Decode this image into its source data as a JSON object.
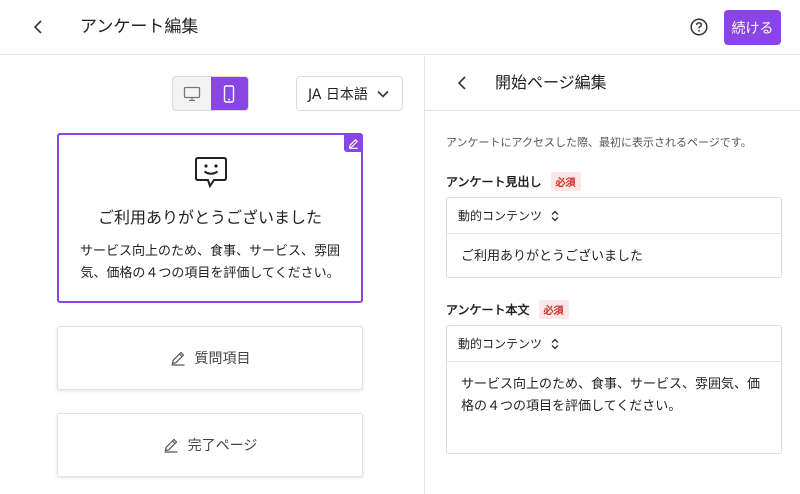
{
  "header": {
    "title": "アンケート編集",
    "continue_label": "続ける"
  },
  "left": {
    "language_label": "JA 日本語",
    "start_card": {
      "heading": "ご利用ありがとうございました",
      "body": "サービス向上のため、食事、サービス、雰囲気、価格の４つの項目を評価してください。"
    },
    "questions_label": "質問項目",
    "complete_label": "完了ページ"
  },
  "right": {
    "title": "開始ページ編集",
    "description": "アンケートにアクセスした際、最初に表示されるページです。",
    "heading_field": {
      "label": "アンケート見出し",
      "required": "必須",
      "type": "動的コンテンツ",
      "value": "ご利用ありがとうございました"
    },
    "body_field": {
      "label": "アンケート本文",
      "required": "必須",
      "type": "動的コンテンツ",
      "value": "サービス向上のため、食事、サービス、雰囲気、価格の４つの項目を評価してください。"
    }
  },
  "colors": {
    "accent": "#8a45e6",
    "required_bg": "#fde6e6",
    "required_text": "#d12d2d"
  },
  "icons": [
    "back-icon",
    "help-icon",
    "desktop-icon",
    "mobile-icon",
    "chevron-down-icon",
    "pencil-icon",
    "smile-chat-icon",
    "sort-icon"
  ]
}
